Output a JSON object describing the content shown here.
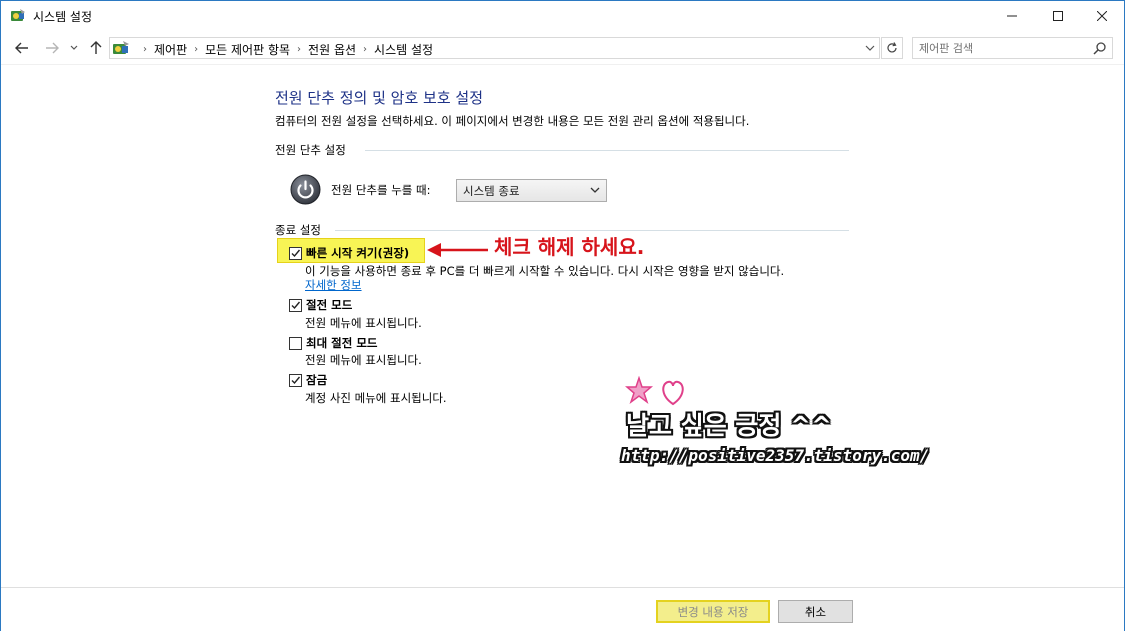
{
  "window": {
    "title": "시스템 설정",
    "icon": "control-panel-icon"
  },
  "nav": {
    "breadcrumbs": [
      "제어판",
      "모든 제어판 항목",
      "전원 옵션",
      "시스템 설정"
    ],
    "search_placeholder": "제어판 검색"
  },
  "main": {
    "title": "전원 단추 정의 및 암호 보호 설정",
    "description": "컴퓨터의 전원 설정을 선택하세요. 이 페이지에서 변경한 내용은 모든 전원 관리 옵션에 적용됩니다.",
    "power_section": {
      "header": "전원 단추 설정",
      "label": "전원 단추를 누를 때:",
      "selected": "시스템 종료"
    },
    "shutdown_section": {
      "header": "종료 설정",
      "items": [
        {
          "label": "빠른 시작 켜기(권장)",
          "checked": true,
          "desc": "이 기능을 사용하면 종료 후 PC를 더 빠르게 시작할 수 있습니다. 다시 시작은 영향을 받지 않습니다.",
          "link": "자세한 정보"
        },
        {
          "label": "절전 모드",
          "checked": true,
          "desc": "전원 메뉴에 표시됩니다."
        },
        {
          "label": "최대 절전 모드",
          "checked": false,
          "desc": "전원 메뉴에 표시됩니다."
        },
        {
          "label": "잠금",
          "checked": true,
          "desc": "계정 사진 메뉴에 표시됩니다."
        }
      ]
    }
  },
  "annotation": {
    "text": "체크 해제 하세요.",
    "color": "#d7141b"
  },
  "watermark": {
    "name": "날고 싶은 긍정 ^^",
    "url": "http://positive2357.tistory.com/"
  },
  "footer": {
    "save_label": "변경 내용 저장",
    "cancel_label": "취소"
  },
  "colors": {
    "title_blue": "#1e3287",
    "link_blue": "#0066cc",
    "highlight_yellow": "#f8f455"
  }
}
